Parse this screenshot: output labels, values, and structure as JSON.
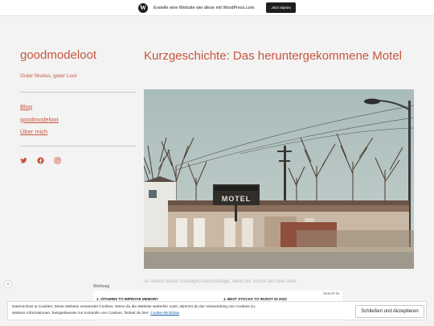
{
  "wp_bar": {
    "text": "Erstelle eine Website wie diese mit WordPress.com",
    "button": "Jetzt starten"
  },
  "sidebar": {
    "site_title": "goodmodeloot",
    "tagline": "Guter Modus, guter Loot",
    "menu": [
      "Blog",
      "goodmodeloot",
      "Über mich"
    ],
    "social_icons": [
      "twitter-icon",
      "facebook-icon",
      "instagram-icon"
    ]
  },
  "post": {
    "title": "Kurzgeschichte: Das heruntergekommene Motel",
    "sign_text": "MOTEL",
    "excerpt": "An einem dieser staubigen Nachmittage, wenn die Sonne tief über dem"
  },
  "ad": {
    "label": "Werbung",
    "search_text": "Search for",
    "items": [
      "1. VITAMINS TO IMPROVE MEMORY",
      "1. BEST STOCKS TO INVEST IN 2022"
    ]
  },
  "cookie": {
    "line1": "Datenschutz & Cookies: Diese Website verwendet Cookies. Wenn du die Website weiterhin nutzt, stimmst du der Verwendung von Cookies zu.",
    "line2": "Weitere Informationen, beispielsweise zur Kontrolle von Cookies, findest du hier:",
    "link": "Cookie-Richtlinie",
    "button": "Schließen und Akzeptieren"
  },
  "colors": {
    "accent": "#c8553d",
    "background": "#f3f3f3"
  }
}
